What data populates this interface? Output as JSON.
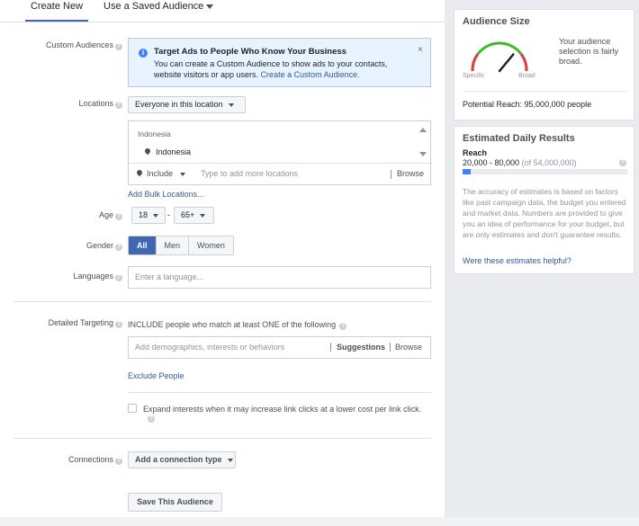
{
  "tabs": {
    "create_new": "Create New",
    "saved_audience": "Use a Saved Audience"
  },
  "custom_audiences": {
    "label": "Custom Audiences",
    "info_title": "Target Ads to People Who Know Your Business",
    "info_body": "You can create a Custom Audience to show ads to your contacts, website visitors or app users.",
    "info_link": "Create a Custom Audience.",
    "close_glyph": "×"
  },
  "locations": {
    "label": "Locations",
    "dropdown": "Everyone in this location",
    "country_heading": "Indonesia",
    "selected_item": "Indonesia",
    "include_label": "Include",
    "input_placeholder": "Type to add more locations",
    "browse": "Browse",
    "bulk_link": "Add Bulk Locations..."
  },
  "age": {
    "label": "Age",
    "min": "18",
    "dash": "-",
    "max": "65+"
  },
  "gender": {
    "label": "Gender",
    "options": [
      "All",
      "Men",
      "Women"
    ],
    "selected": "All"
  },
  "languages": {
    "label": "Languages",
    "placeholder": "Enter a language..."
  },
  "detailed_targeting": {
    "label": "Detailed Targeting",
    "include_text": "INCLUDE people who match at least ONE of the following",
    "placeholder": "Add demographics, interests or behaviors",
    "suggestions": "Suggestions",
    "browse": "Browse",
    "exclude_link": "Exclude People",
    "expand_text": "Expand interests when it may increase link clicks at a lower cost per link click."
  },
  "connections": {
    "label": "Connections",
    "dropdown": "Add a connection type"
  },
  "save_button": "Save This Audience",
  "audience_size": {
    "title": "Audience Size",
    "specific": "Specific",
    "broad": "Broad",
    "description": "Your audience selection is fairly broad.",
    "potential_reach": "Potential Reach: 95,000,000 people",
    "gauge_level": 0.72
  },
  "daily_results": {
    "title": "Estimated Daily Results",
    "reach_label": "Reach",
    "reach_value": "20,000 - 80,000",
    "reach_total": "(of 54,000,000)",
    "reach_fraction": 0.05,
    "description": "The accuracy of estimates is based on factors like past campaign data, the budget you entered and market data. Numbers are provided to give you an idea of performance for your budget, but are only estimates and don't guarantee results.",
    "helpful_link": "Were these estimates helpful?"
  },
  "colors": {
    "accent": "#4267b2",
    "link": "#365899",
    "gauge_red": "#e0393e",
    "gauge_yellow": "#f7b928",
    "gauge_green": "#42b72a",
    "reach_bar": "#4080ff"
  }
}
